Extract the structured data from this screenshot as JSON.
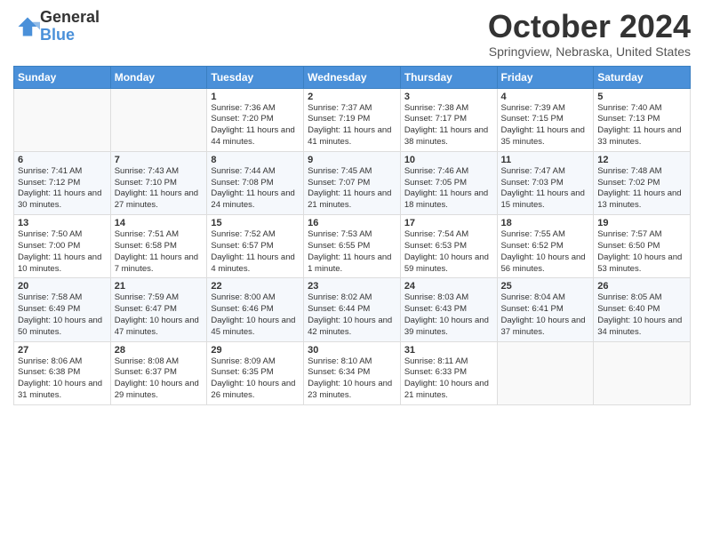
{
  "header": {
    "logo_general": "General",
    "logo_blue": "Blue",
    "month_title": "October 2024",
    "location": "Springview, Nebraska, United States"
  },
  "days_of_week": [
    "Sunday",
    "Monday",
    "Tuesday",
    "Wednesday",
    "Thursday",
    "Friday",
    "Saturday"
  ],
  "weeks": [
    [
      {
        "num": "",
        "sunrise": "",
        "sunset": "",
        "daylight": ""
      },
      {
        "num": "",
        "sunrise": "",
        "sunset": "",
        "daylight": ""
      },
      {
        "num": "1",
        "sunrise": "Sunrise: 7:36 AM",
        "sunset": "Sunset: 7:20 PM",
        "daylight": "Daylight: 11 hours and 44 minutes."
      },
      {
        "num": "2",
        "sunrise": "Sunrise: 7:37 AM",
        "sunset": "Sunset: 7:19 PM",
        "daylight": "Daylight: 11 hours and 41 minutes."
      },
      {
        "num": "3",
        "sunrise": "Sunrise: 7:38 AM",
        "sunset": "Sunset: 7:17 PM",
        "daylight": "Daylight: 11 hours and 38 minutes."
      },
      {
        "num": "4",
        "sunrise": "Sunrise: 7:39 AM",
        "sunset": "Sunset: 7:15 PM",
        "daylight": "Daylight: 11 hours and 35 minutes."
      },
      {
        "num": "5",
        "sunrise": "Sunrise: 7:40 AM",
        "sunset": "Sunset: 7:13 PM",
        "daylight": "Daylight: 11 hours and 33 minutes."
      }
    ],
    [
      {
        "num": "6",
        "sunrise": "Sunrise: 7:41 AM",
        "sunset": "Sunset: 7:12 PM",
        "daylight": "Daylight: 11 hours and 30 minutes."
      },
      {
        "num": "7",
        "sunrise": "Sunrise: 7:43 AM",
        "sunset": "Sunset: 7:10 PM",
        "daylight": "Daylight: 11 hours and 27 minutes."
      },
      {
        "num": "8",
        "sunrise": "Sunrise: 7:44 AM",
        "sunset": "Sunset: 7:08 PM",
        "daylight": "Daylight: 11 hours and 24 minutes."
      },
      {
        "num": "9",
        "sunrise": "Sunrise: 7:45 AM",
        "sunset": "Sunset: 7:07 PM",
        "daylight": "Daylight: 11 hours and 21 minutes."
      },
      {
        "num": "10",
        "sunrise": "Sunrise: 7:46 AM",
        "sunset": "Sunset: 7:05 PM",
        "daylight": "Daylight: 11 hours and 18 minutes."
      },
      {
        "num": "11",
        "sunrise": "Sunrise: 7:47 AM",
        "sunset": "Sunset: 7:03 PM",
        "daylight": "Daylight: 11 hours and 15 minutes."
      },
      {
        "num": "12",
        "sunrise": "Sunrise: 7:48 AM",
        "sunset": "Sunset: 7:02 PM",
        "daylight": "Daylight: 11 hours and 13 minutes."
      }
    ],
    [
      {
        "num": "13",
        "sunrise": "Sunrise: 7:50 AM",
        "sunset": "Sunset: 7:00 PM",
        "daylight": "Daylight: 11 hours and 10 minutes."
      },
      {
        "num": "14",
        "sunrise": "Sunrise: 7:51 AM",
        "sunset": "Sunset: 6:58 PM",
        "daylight": "Daylight: 11 hours and 7 minutes."
      },
      {
        "num": "15",
        "sunrise": "Sunrise: 7:52 AM",
        "sunset": "Sunset: 6:57 PM",
        "daylight": "Daylight: 11 hours and 4 minutes."
      },
      {
        "num": "16",
        "sunrise": "Sunrise: 7:53 AM",
        "sunset": "Sunset: 6:55 PM",
        "daylight": "Daylight: 11 hours and 1 minute."
      },
      {
        "num": "17",
        "sunrise": "Sunrise: 7:54 AM",
        "sunset": "Sunset: 6:53 PM",
        "daylight": "Daylight: 10 hours and 59 minutes."
      },
      {
        "num": "18",
        "sunrise": "Sunrise: 7:55 AM",
        "sunset": "Sunset: 6:52 PM",
        "daylight": "Daylight: 10 hours and 56 minutes."
      },
      {
        "num": "19",
        "sunrise": "Sunrise: 7:57 AM",
        "sunset": "Sunset: 6:50 PM",
        "daylight": "Daylight: 10 hours and 53 minutes."
      }
    ],
    [
      {
        "num": "20",
        "sunrise": "Sunrise: 7:58 AM",
        "sunset": "Sunset: 6:49 PM",
        "daylight": "Daylight: 10 hours and 50 minutes."
      },
      {
        "num": "21",
        "sunrise": "Sunrise: 7:59 AM",
        "sunset": "Sunset: 6:47 PM",
        "daylight": "Daylight: 10 hours and 47 minutes."
      },
      {
        "num": "22",
        "sunrise": "Sunrise: 8:00 AM",
        "sunset": "Sunset: 6:46 PM",
        "daylight": "Daylight: 10 hours and 45 minutes."
      },
      {
        "num": "23",
        "sunrise": "Sunrise: 8:02 AM",
        "sunset": "Sunset: 6:44 PM",
        "daylight": "Daylight: 10 hours and 42 minutes."
      },
      {
        "num": "24",
        "sunrise": "Sunrise: 8:03 AM",
        "sunset": "Sunset: 6:43 PM",
        "daylight": "Daylight: 10 hours and 39 minutes."
      },
      {
        "num": "25",
        "sunrise": "Sunrise: 8:04 AM",
        "sunset": "Sunset: 6:41 PM",
        "daylight": "Daylight: 10 hours and 37 minutes."
      },
      {
        "num": "26",
        "sunrise": "Sunrise: 8:05 AM",
        "sunset": "Sunset: 6:40 PM",
        "daylight": "Daylight: 10 hours and 34 minutes."
      }
    ],
    [
      {
        "num": "27",
        "sunrise": "Sunrise: 8:06 AM",
        "sunset": "Sunset: 6:38 PM",
        "daylight": "Daylight: 10 hours and 31 minutes."
      },
      {
        "num": "28",
        "sunrise": "Sunrise: 8:08 AM",
        "sunset": "Sunset: 6:37 PM",
        "daylight": "Daylight: 10 hours and 29 minutes."
      },
      {
        "num": "29",
        "sunrise": "Sunrise: 8:09 AM",
        "sunset": "Sunset: 6:35 PM",
        "daylight": "Daylight: 10 hours and 26 minutes."
      },
      {
        "num": "30",
        "sunrise": "Sunrise: 8:10 AM",
        "sunset": "Sunset: 6:34 PM",
        "daylight": "Daylight: 10 hours and 23 minutes."
      },
      {
        "num": "31",
        "sunrise": "Sunrise: 8:11 AM",
        "sunset": "Sunset: 6:33 PM",
        "daylight": "Daylight: 10 hours and 21 minutes."
      },
      {
        "num": "",
        "sunrise": "",
        "sunset": "",
        "daylight": ""
      },
      {
        "num": "",
        "sunrise": "",
        "sunset": "",
        "daylight": ""
      }
    ]
  ]
}
